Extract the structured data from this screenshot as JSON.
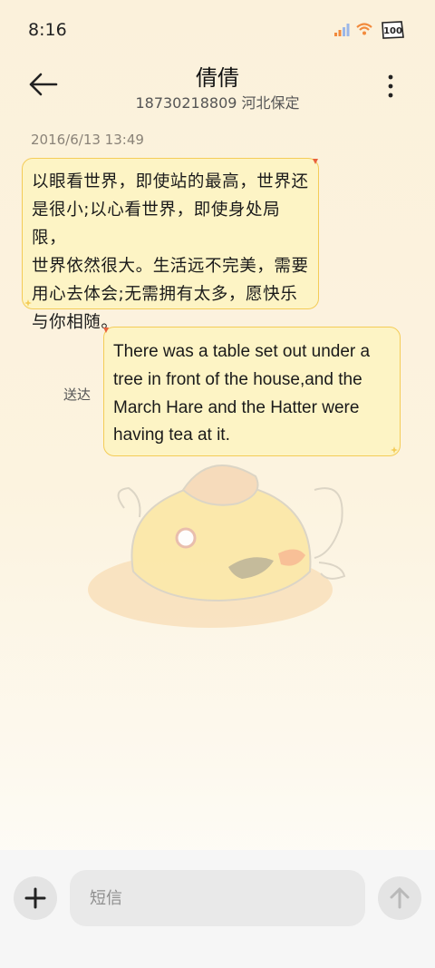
{
  "status_bar": {
    "time": "8:16",
    "battery": "100",
    "icons": [
      "signal-icon",
      "wifi-icon",
      "battery-icon"
    ]
  },
  "header": {
    "contact_name": "倩倩",
    "contact_detail": "18730218809 河北保定",
    "icons": [
      "back-arrow-icon",
      "more-vertical-icon"
    ]
  },
  "conversation": {
    "timestamp": "2016/6/13 13:49",
    "messages": [
      {
        "direction": "incoming",
        "lines": [
          "以眼看世界，即使站的最高，世界还",
          "是很小;以心看世界，即使身处局限，",
          "世界依然很大。生活远不完美，需要",
          "用心去体会;无需拥有太多，愿快乐",
          "与你相随。"
        ]
      },
      {
        "direction": "outgoing",
        "status": "送达",
        "lines": [
          "There was a table set out under a",
          "tree in front of the house,and the",
          "March Hare and the Hatter were",
          "having tea at it."
        ]
      }
    ]
  },
  "composer": {
    "placeholder": "短信",
    "icons": [
      "plus-icon",
      "send-arrow-icon"
    ]
  },
  "colors": {
    "bubble_fill": "#fdf4c5",
    "bubble_border": "#f4cc57",
    "background": "#fbf1db"
  }
}
